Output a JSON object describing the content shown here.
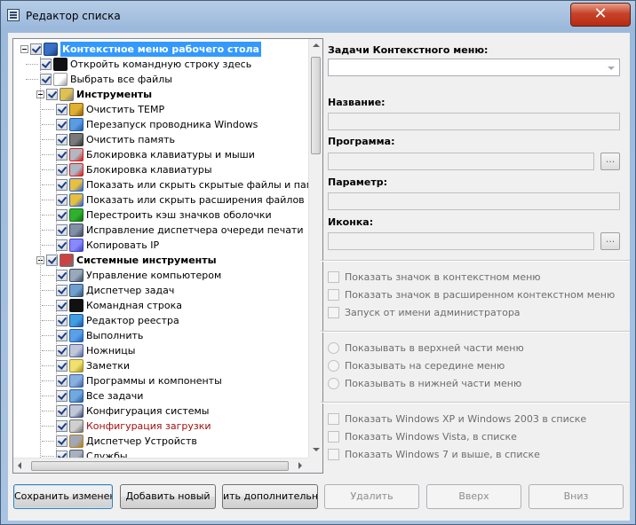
{
  "window": {
    "title": "Редактор списка",
    "close_glyph": "✕"
  },
  "tree": {
    "root": "Контекстное меню рабочего стола",
    "items": [
      {
        "label": "Откройть командную строку здесь",
        "icon": "cmd-icon"
      },
      {
        "label": "Выбрать все файлы",
        "icon": "file-icon"
      }
    ],
    "tools_group": "Инструменты",
    "tools": [
      {
        "label": "Очистить TEMP",
        "icon": "broom-icon"
      },
      {
        "label": "Перезапуск проводника Windows",
        "icon": "explorer-restart-icon"
      },
      {
        "label": "Очистить память",
        "icon": "memory-icon"
      },
      {
        "label": "Блокировка клавиатуры и мыши",
        "icon": "keyboard-mouse-lock-icon"
      },
      {
        "label": "Блокировка клавиатуры",
        "icon": "keyboard-lock-icon"
      },
      {
        "label": "Показать или скрыть скрытые файлы и папки",
        "icon": "hidden-files-icon"
      },
      {
        "label": "Показать или скрыть расширения файлов",
        "icon": "extensions-icon"
      },
      {
        "label": "Перестроить кэш значков оболочки",
        "icon": "refresh-icon"
      },
      {
        "label": "Исправление диспетчера очереди печати",
        "icon": "printer-icon"
      },
      {
        "label": "Копировать IP",
        "icon": "ip-icon"
      }
    ],
    "system_group": "Системные инструменты",
    "system": [
      {
        "label": "Управление компьютером",
        "icon": "computer-management-icon"
      },
      {
        "label": "Диспетчер задач",
        "icon": "task-manager-icon"
      },
      {
        "label": "Командная строка",
        "icon": "cmd-icon"
      },
      {
        "label": "Редактор реестра",
        "icon": "regedit-icon"
      },
      {
        "label": "Выполнить",
        "icon": "run-icon"
      },
      {
        "label": "Ножницы",
        "icon": "scissors-icon"
      },
      {
        "label": "Заметки",
        "icon": "notes-icon"
      },
      {
        "label": "Программы и компоненты",
        "icon": "programs-icon"
      },
      {
        "label": "Все задачи",
        "icon": "all-tasks-icon"
      },
      {
        "label": "Конфигурация системы",
        "icon": "msconfig-icon"
      },
      {
        "label": "Конфигурация загрузки",
        "icon": "boot-config-icon",
        "color": "#a01010"
      },
      {
        "label": "Диспетчер Устройств",
        "icon": "device-manager-icon"
      },
      {
        "label": "Службы",
        "icon": "services-icon"
      }
    ]
  },
  "panel": {
    "tasks_label": "Задачи Контекстного меню:",
    "tasks_value": "",
    "name_label": "Название:",
    "name_value": "",
    "program_label": "Программа:",
    "program_value": "",
    "param_label": "Параметр:",
    "param_value": "",
    "icon_label": "Иконка:",
    "icon_value": "",
    "browse": "...",
    "checks1": [
      "Показать значок в контекстном меню",
      "Показать значок в расширенном контекстном меню",
      "Запуск от имени администратора"
    ],
    "radios": [
      "Показывать в верхней части меню",
      "Показывать на середине меню",
      "Показывать в нижней части меню"
    ],
    "checks2": [
      "Показать Windows XP и Windows 2003 в списке",
      "Показать Windows Vista, в списке",
      "Показать Windows 7 и выше, в списке"
    ]
  },
  "buttons": {
    "save": "Сохранить изменения",
    "add": "Добавить новый",
    "extra": "ить дополнительное",
    "delete": "Удалить",
    "up": "Вверх",
    "down": "Вниз"
  }
}
